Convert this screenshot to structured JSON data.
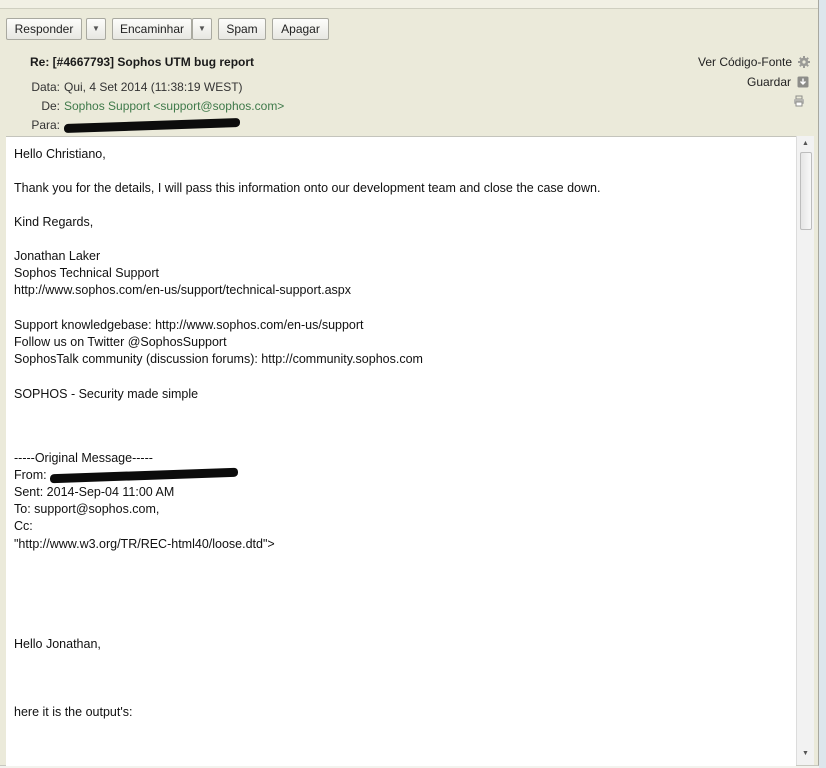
{
  "toolbar": {
    "reply": "Responder",
    "forward": "Encaminhar",
    "spam": "Spam",
    "delete": "Apagar"
  },
  "header": {
    "subject": "Re: [#4667793] Sophos UTM bug report",
    "date_label": "Data:",
    "date_value": "Qui, 4 Set 2014 (11:38:19 WEST)",
    "from_label": "De:",
    "from_value": "Sophos Support <support@sophos.com>",
    "to_label": "Para:",
    "view_source": "Ver Código-Fonte",
    "save": "Guardar"
  },
  "body": {
    "greeting": "Hello Christiano,",
    "line1": "Thank you for the details, I will pass this information onto our development team and close the case down.",
    "regards": "Kind Regards,",
    "sig_name": "Jonathan Laker",
    "sig_title": "Sophos Technical Support",
    "sig_url": "http://www.sophos.com/en-us/support/technical-support.aspx",
    "kb": "Support knowledgebase: http://www.sophos.com/en-us/support",
    "twitter": "Follow us on Twitter @SophosSupport",
    "community": "SophosTalk community (discussion forums): http://community.sophos.com",
    "tagline": "SOPHOS - Security made simple",
    "orig_header": "-----Original Message-----",
    "from": "From:",
    "sent": "Sent: 2014-Sep-04 11:00 AM",
    "to": "To: support@sophos.com,",
    "cc": "Cc:",
    "dtd": "\"http://www.w3.org/TR/REC-html40/loose.dtd\">",
    "hello2": "Hello Jonathan,",
    "output": "here it is the output's:"
  },
  "icons": {
    "gear": "gear-icon",
    "save": "download-icon",
    "print": "printer-icon"
  }
}
